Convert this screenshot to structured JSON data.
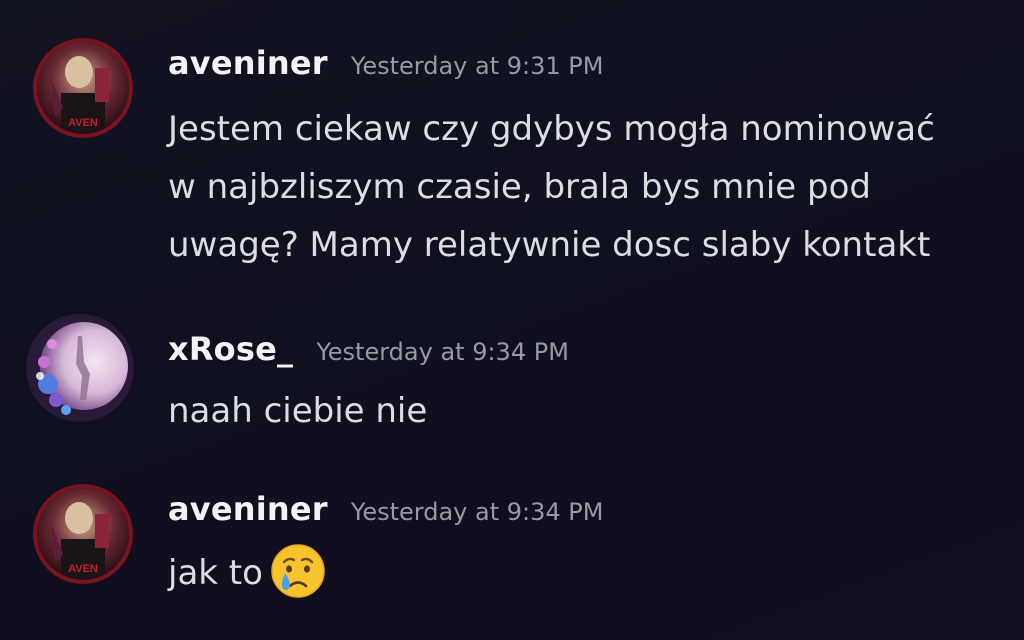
{
  "messages": [
    {
      "author": "aveniner",
      "timestamp": "Yesterday at 9:31 PM",
      "avatar": "aveniner-avatar",
      "lines": [
        "Jestem ciekaw czy gdybys mogła nominować",
        "w najbzliszym czasie, brala bys mnie pod",
        "uwagę? Mamy relatywnie dosc slaby kontakt"
      ]
    },
    {
      "author": "xRose_",
      "timestamp": "Yesterday at 9:34 PM",
      "avatar": "xrose-avatar",
      "lines": [
        "naah ciebie nie"
      ]
    },
    {
      "author": "aveniner",
      "timestamp": "Yesterday at 9:34 PM",
      "avatar": "aveniner-avatar",
      "text": "jak to",
      "emoji": "crying-face-emoji"
    }
  ],
  "avatar_badge_text": "AVEN",
  "colors": {
    "background": "#10101f",
    "username": "#f2f3f5",
    "timestamp": "#949ba4",
    "message_text": "#dbdee1"
  }
}
